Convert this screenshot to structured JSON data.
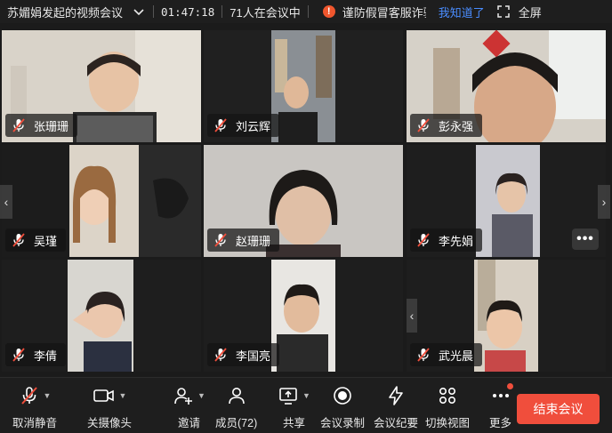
{
  "topbar": {
    "meeting_title": "苏媚娟发起的视频会议",
    "timer": "01:47:18",
    "attendee_count": "71人在会议中",
    "notice_text": "谨防假冒客服诈骗",
    "notice_ack": "我知道了",
    "fullscreen_label": "全屏"
  },
  "participants": [
    {
      "name": "张珊珊"
    },
    {
      "name": "刘云辉"
    },
    {
      "name": "彭永强"
    },
    {
      "name": "吴瑾"
    },
    {
      "name": "赵珊珊"
    },
    {
      "name": "李先娟"
    },
    {
      "name": "李倩"
    },
    {
      "name": "李国亮"
    },
    {
      "name": "武光晨"
    }
  ],
  "more_dots": "•••",
  "toolbar": {
    "unmute": "取消静音",
    "camera_off": "关摄像头",
    "invite": "邀请",
    "members": "成员(72)",
    "share": "共享",
    "record": "会议录制",
    "minutes": "会议纪要",
    "switch_view": "切换视图",
    "more": "更多",
    "end_meeting": "结束会议"
  },
  "colors": {
    "accent_link": "#4a8dff",
    "end_button": "#f04e3c",
    "warning": "#f0562d"
  }
}
